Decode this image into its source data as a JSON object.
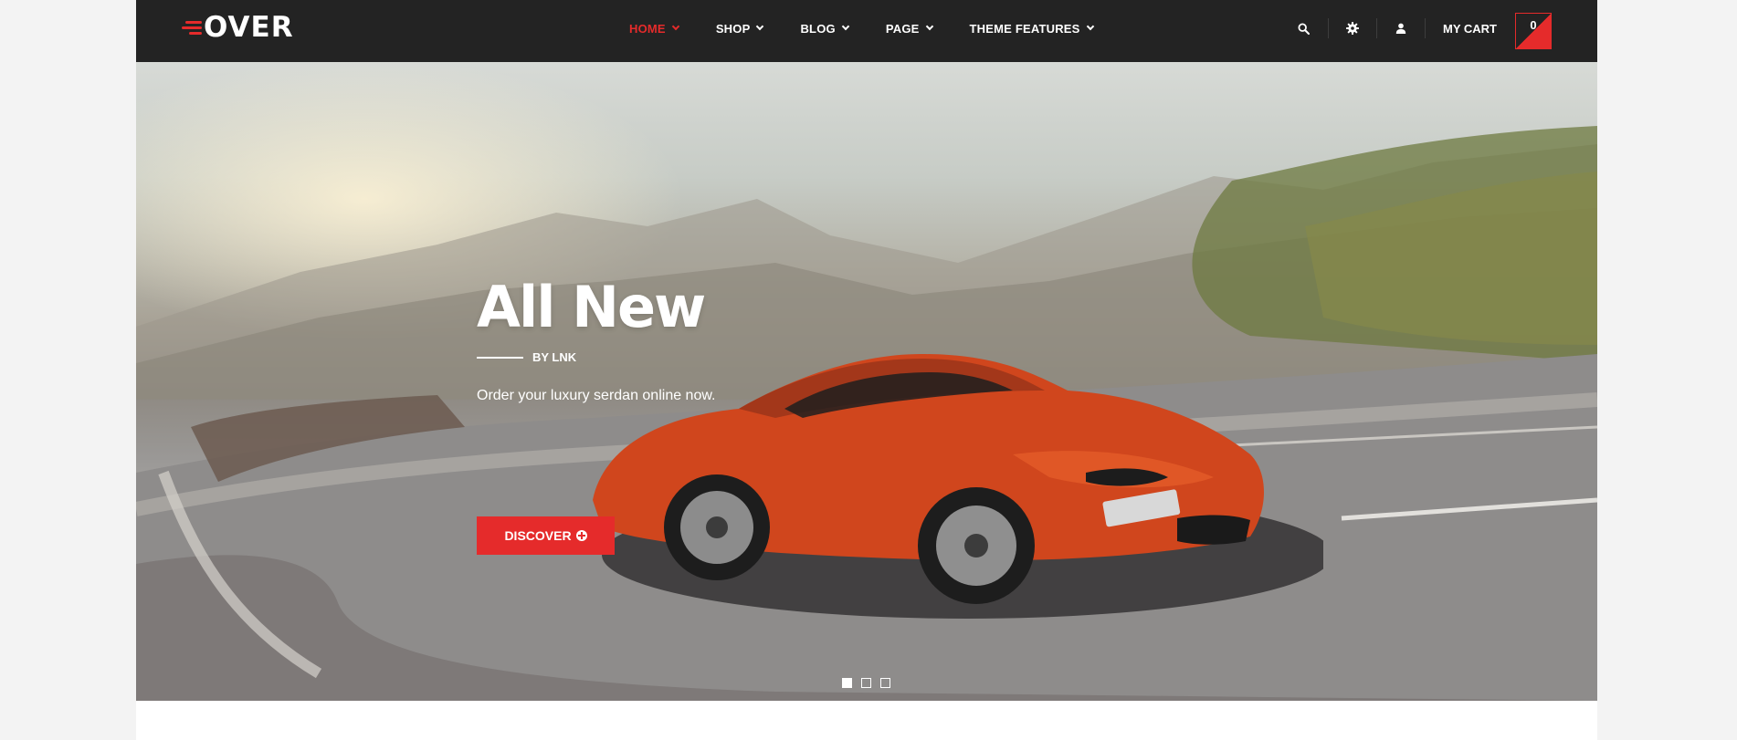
{
  "logo": {
    "text": "OVER",
    "accent_color": "#e52b2b"
  },
  "nav": {
    "items": [
      {
        "label": "Home",
        "active": true
      },
      {
        "label": "Shop",
        "active": false
      },
      {
        "label": "Blog",
        "active": false
      },
      {
        "label": "Page",
        "active": false
      },
      {
        "label": "Theme Features",
        "active": false
      }
    ]
  },
  "tools": {
    "search_icon": "search-icon",
    "settings_icon": "gear-icon",
    "account_icon": "user-icon",
    "cart_label": "MY CART",
    "cart_count": "0"
  },
  "hero": {
    "title": "All New",
    "byline": "BY LNK",
    "subtitle": "Order your luxury serdan online now.",
    "button_label": "DISCOVER",
    "button_icon": "plus-circle-icon",
    "slides": [
      {
        "active": true
      },
      {
        "active": false
      },
      {
        "active": false
      }
    ]
  },
  "colors": {
    "accent": "#e52b2b",
    "header_bg": "#232323",
    "page_bg": "#f3f3f3"
  }
}
